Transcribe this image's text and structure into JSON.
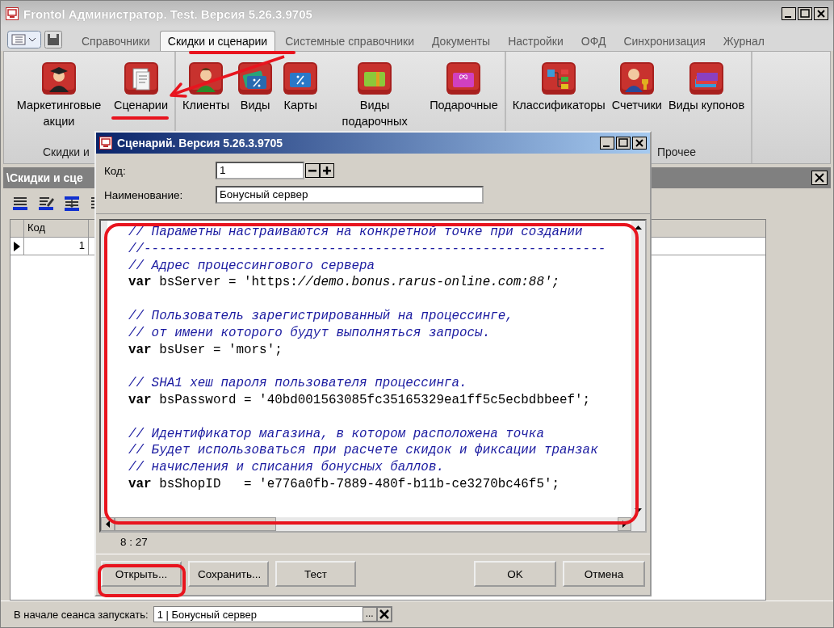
{
  "window": {
    "title": "Frontol Администратор. Test. Версия 5.26.3.9705"
  },
  "menu_tabs": [
    {
      "label": "Справочники",
      "selected": false
    },
    {
      "label": "Скидки и сценарии",
      "selected": true
    },
    {
      "label": "Системные справочники",
      "selected": false
    },
    {
      "label": "Документы",
      "selected": false
    },
    {
      "label": "Настройки",
      "selected": false
    },
    {
      "label": "ОФД",
      "selected": false
    },
    {
      "label": "Синхронизация",
      "selected": false
    },
    {
      "label": "Журнал",
      "selected": false
    }
  ],
  "ribbon": {
    "groups": [
      {
        "label": "Скидки и",
        "items": [
          {
            "label": "Маркетинговые акции",
            "kind": "graduate"
          },
          {
            "label": "Сценарии",
            "kind": "document"
          }
        ]
      },
      {
        "items": [
          {
            "label": "Клиенты",
            "kind": "person"
          },
          {
            "label": "Виды",
            "kind": "cards"
          },
          {
            "label": "Карты",
            "kind": "card"
          },
          {
            "label": "Виды подарочных",
            "kind": "giftcard"
          },
          {
            "label": "Подарочные",
            "kind": "gift"
          }
        ]
      },
      {
        "label": "Прочее",
        "items": [
          {
            "label": "Классификаторы",
            "kind": "tree"
          },
          {
            "label": "Счетчики",
            "kind": "trophy"
          },
          {
            "label": "Виды купонов",
            "kind": "coupons"
          }
        ]
      }
    ]
  },
  "subwindow": {
    "title": "\\Скидки и сце",
    "columns": [
      "Код"
    ],
    "rows": [
      {
        "cells": [
          "1"
        ],
        "selected": true
      }
    ]
  },
  "startup": {
    "label": "В начале сеанса запускать:",
    "value": "1 | Бонусный сервер",
    "browse": "..."
  },
  "dialog": {
    "title": "Сценарий. Версия 5.26.3.9705",
    "code_label": "Код:",
    "code_value": "1",
    "name_label": "Наименование:",
    "name_value": "Бонусный сервер",
    "lines": [
      {
        "kind": "comment",
        "text": "// Параметны настраиваются на конкретной точке при создании"
      },
      {
        "kind": "comment",
        "text": "//------------------------------------------------------------"
      },
      {
        "kind": "comment",
        "text": "// Адрес процессингового сервера"
      },
      {
        "kind": "code",
        "text": "**var** bsServer = 'https:*//demo.bonus.rarus-online.com:88';*"
      },
      {
        "kind": "blank"
      },
      {
        "kind": "comment",
        "text": "// Пользователь зарегистрированный на процессинге,"
      },
      {
        "kind": "comment",
        "text": "// от имени которого будут выполняться запросы."
      },
      {
        "kind": "code",
        "text": "**var** bsUser = 'mors';"
      },
      {
        "kind": "blank"
      },
      {
        "kind": "comment",
        "text": "// SHA1 хеш пароля пользователя процессинга."
      },
      {
        "kind": "code",
        "text": "**var** bsPassword = '40bd001563085fc35165329ea1ff5c5ecbdbbeef';"
      },
      {
        "kind": "blank"
      },
      {
        "kind": "comment",
        "text": "// Идентификатор магазина, в котором расположена точка"
      },
      {
        "kind": "comment",
        "text": "// Будет использоваться при расчете скидок и фиксации транзак"
      },
      {
        "kind": "comment",
        "text": "// начисления и списания бонусных баллов."
      },
      {
        "kind": "code",
        "text": "**var** bsShopID   = 'e776a0fb-7889-480f-b11b-ce3270bc46f5';"
      }
    ],
    "position": "8 : 27",
    "buttons": [
      {
        "label": "Открыть...",
        "kind": "left"
      },
      {
        "label": "Сохранить...",
        "kind": "left"
      },
      {
        "label": "Тест",
        "kind": "left"
      },
      {
        "label": "OK",
        "kind": "right"
      },
      {
        "label": "Отмена",
        "kind": "right"
      }
    ]
  }
}
